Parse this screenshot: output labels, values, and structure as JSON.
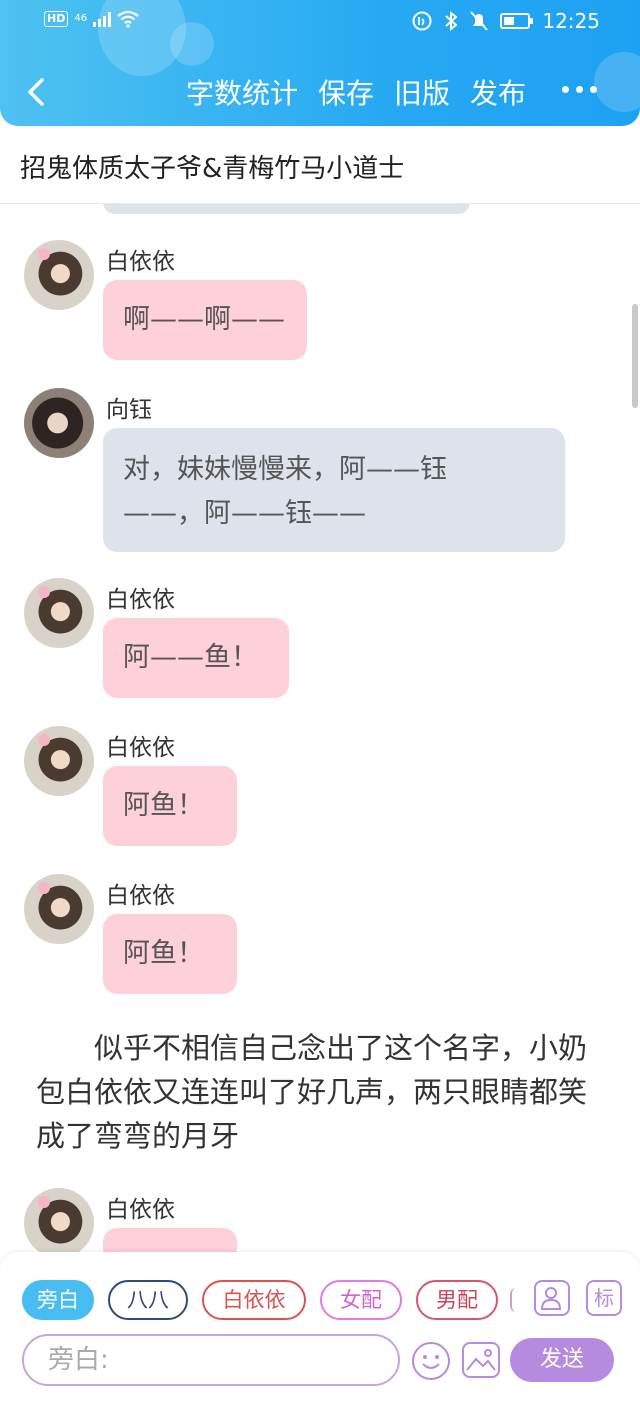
{
  "status_bar": {
    "hd": "HD",
    "network": "46",
    "time": "12:25"
  },
  "nav": {
    "actions": [
      "字数统计",
      "保存",
      "旧版",
      "发布"
    ]
  },
  "story_title": "招鬼体质太子爷&青梅竹马小道士",
  "messages": [
    {
      "name": "白依依",
      "text": "啊——啊——",
      "style": "pink"
    },
    {
      "name": "向钰",
      "lines": [
        "对，妹妹慢慢来，阿——钰",
        "——，阿——钰——"
      ],
      "style": "grey"
    },
    {
      "name": "白依依",
      "text": "阿——鱼！",
      "style": "pink"
    },
    {
      "name": "白依依",
      "text": "阿鱼！",
      "style": "pink"
    },
    {
      "name": "白依依",
      "text": "阿鱼！",
      "style": "pink"
    }
  ],
  "narration": "似乎不相信自己念出了这个名字，小奶包白依依又连连叫了好几声，两只眼睛都笑成了弯弯的月牙",
  "last_message_name": "白依依",
  "roles": [
    "旁白",
    "八八",
    "白依依",
    "女配",
    "男配"
  ],
  "tools": {
    "tag_label": "标"
  },
  "input": {
    "placeholder": "旁白:"
  },
  "send_label": "发送",
  "colors": {
    "accent_blue": "#27a9f2",
    "accent_purple": "#b58be0",
    "bubble_pink": "#fdd0da",
    "bubble_grey": "#dde2eb"
  }
}
